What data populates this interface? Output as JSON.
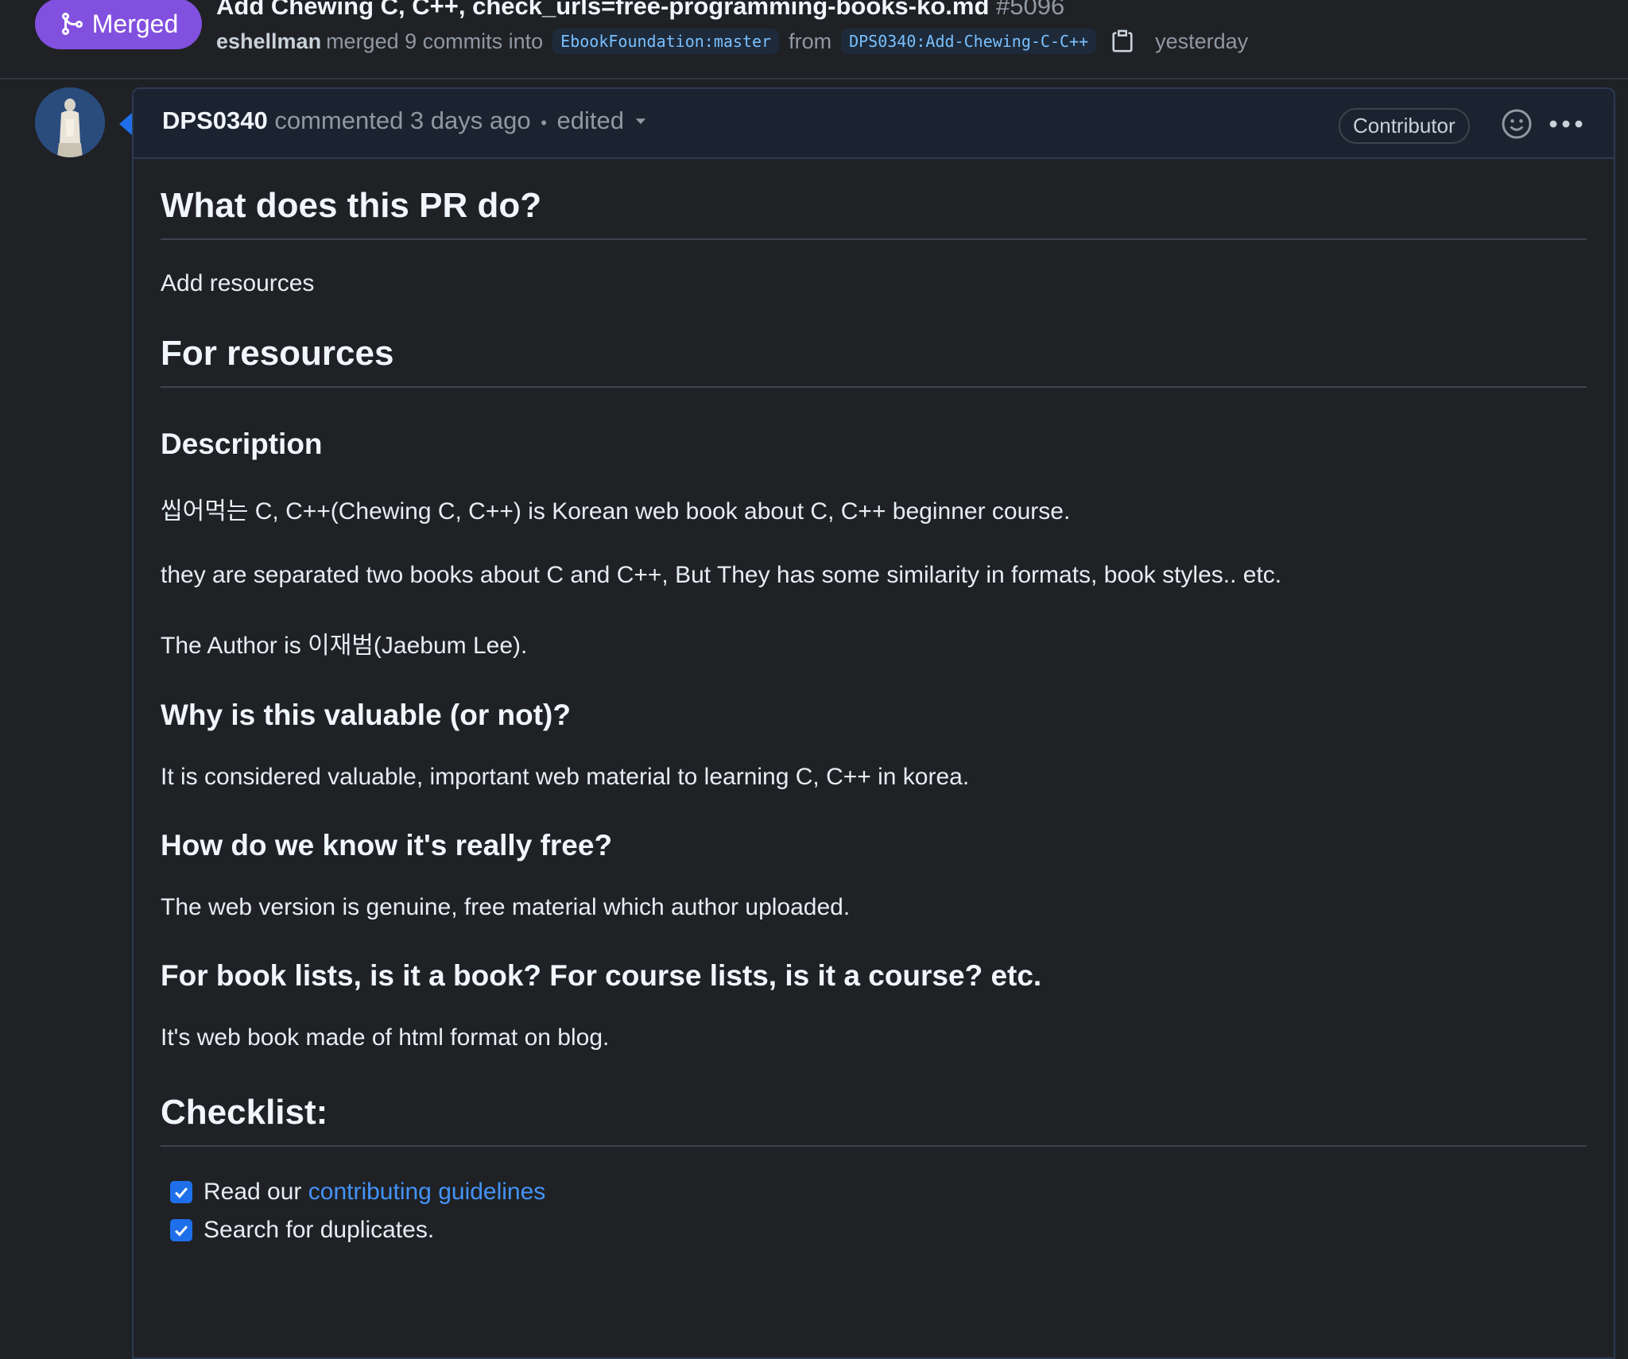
{
  "pr": {
    "status_label": "Merged",
    "title": "Add Chewing C, C++, check_urls=free-programming-books-ko.md",
    "number": "#5096",
    "merged_by": "eshellman",
    "merged_text": "merged 9 commits into",
    "base_branch": "EbookFoundation:master",
    "from_text": "from",
    "head_branch": "DPS0340:Add-Chewing-C-C++",
    "merged_time": "yesterday"
  },
  "comment": {
    "author": "DPS0340",
    "action": "commented 3 days ago",
    "separator": "•",
    "edited_label": "edited",
    "role_badge": "Contributor"
  },
  "body": {
    "h_what": "What does this PR do?",
    "p_what": "Add resources",
    "h_for": "For resources",
    "h_desc": "Description",
    "p_desc1": "씹어먹는 C, C++(Chewing C, C++) is Korean web book about C, C++ beginner course.",
    "p_desc2": "they are separated two books about C and C++, But They has some similarity in formats, book styles.. etc.",
    "p_desc3": "The Author is 이재범(Jaebum Lee).",
    "h_why": "Why is this valuable (or not)?",
    "p_why": "It is considered valuable, important web material to learning C, C++ in korea.",
    "h_free": "How do we know it's really free?",
    "p_free": "The web version is genuine, free material which author uploaded.",
    "h_book": "For book lists, is it a book? For course lists, is it a course? etc.",
    "p_book": "It's web book made of html format on blog.",
    "h_check": "Checklist:",
    "check1_prefix": "Read our",
    "check1_link": "contributing guidelines",
    "check2": "Search for duplicates."
  },
  "colors": {
    "merged": "#8250df",
    "link": "#4493f8",
    "checkbox": "#1f6feb",
    "background": "#1f2125"
  },
  "icons": [
    "git-merge-icon",
    "copy-icon",
    "chevron-down-icon",
    "smiley-icon",
    "kebab-menu-icon",
    "check-icon"
  ]
}
